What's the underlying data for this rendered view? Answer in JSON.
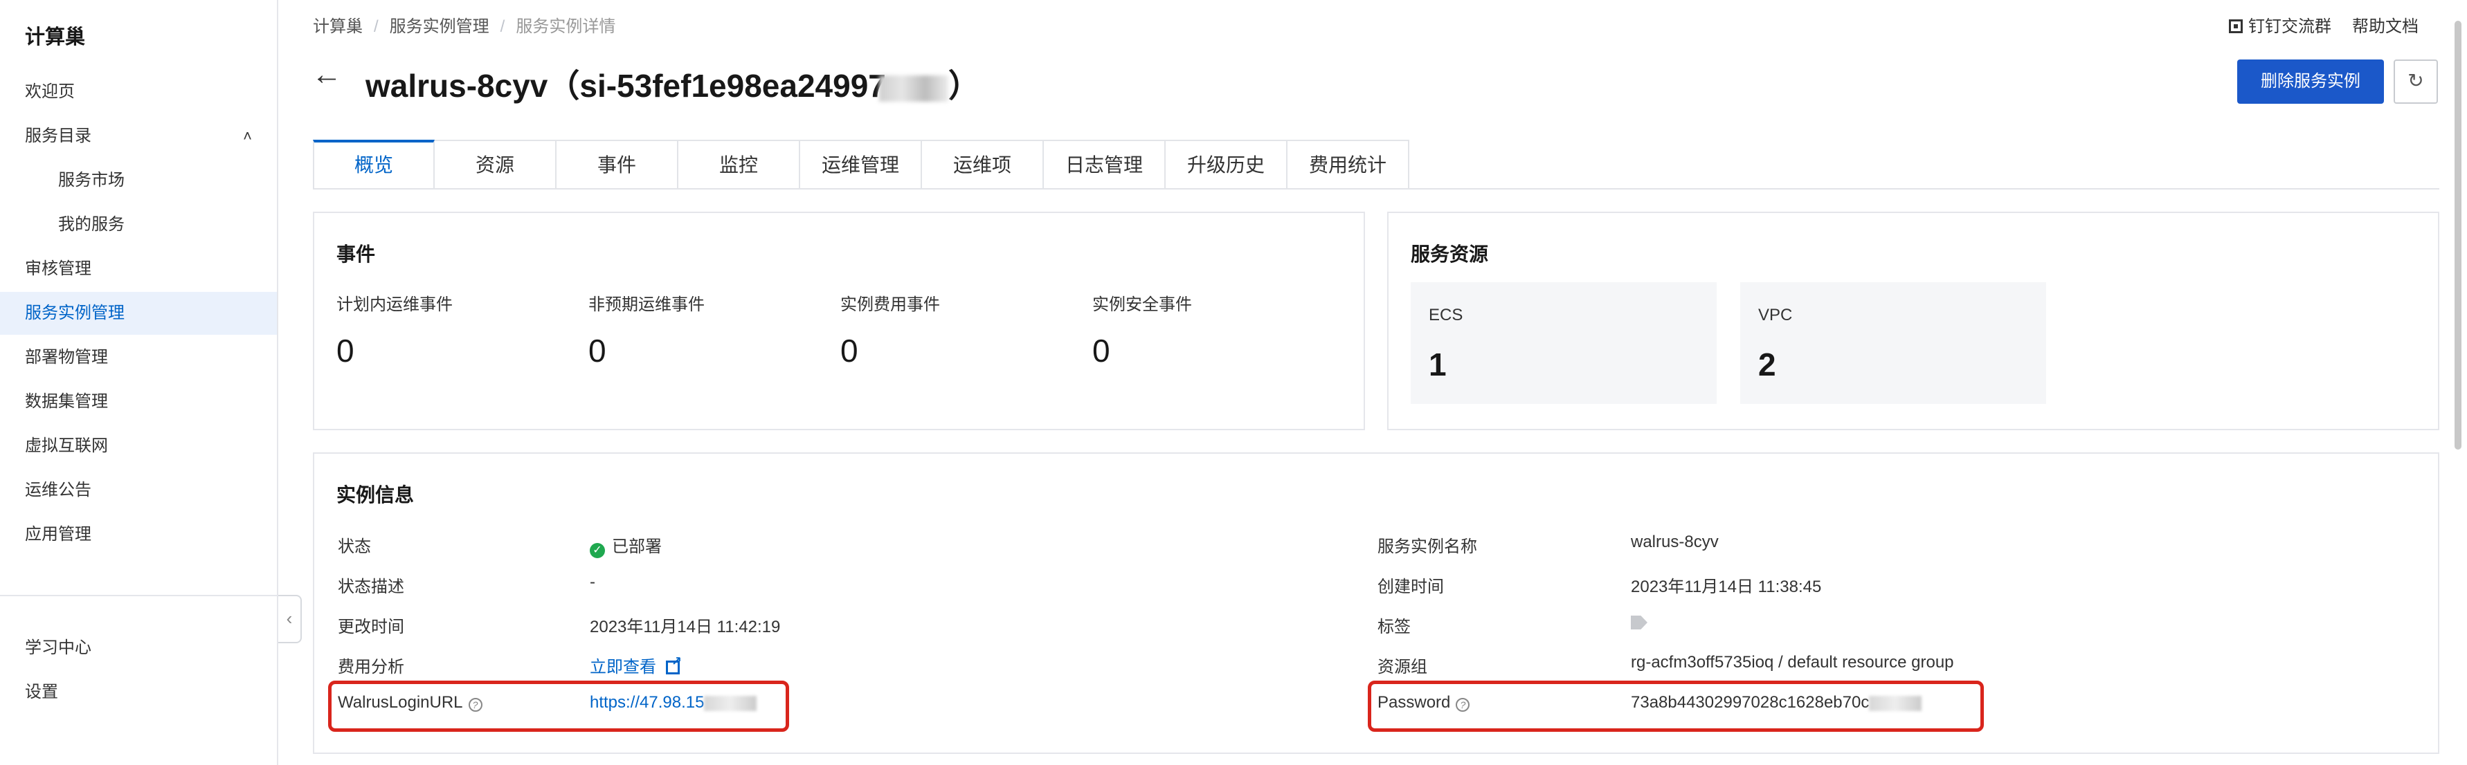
{
  "sidebar": {
    "title": "计算巢",
    "items": [
      {
        "label": "欢迎页"
      },
      {
        "label": "服务目录",
        "chevron": "^"
      },
      {
        "label": "服务市场"
      },
      {
        "label": "我的服务"
      },
      {
        "label": "审核管理"
      },
      {
        "label": "服务实例管理"
      },
      {
        "label": "部署物管理"
      },
      {
        "label": "数据集管理"
      },
      {
        "label": "虚拟互联网"
      },
      {
        "label": "运维公告"
      },
      {
        "label": "应用管理"
      }
    ],
    "bottom_items": [
      {
        "label": "学习中心"
      },
      {
        "label": "设置"
      }
    ],
    "collapse_glyph": "‹"
  },
  "breadcrumb": [
    "计算巢",
    "服务实例管理",
    "服务实例详情"
  ],
  "top_links": {
    "dingtalk": "钉钉交流群",
    "help": "帮助文档"
  },
  "header": {
    "back_glyph": "←",
    "title": "walrus-8cyv（si-53fef1e98ea24997",
    "title_suffix": "）",
    "delete_button": "删除服务实例",
    "refresh_glyph": "↻"
  },
  "tabs": [
    "概览",
    "资源",
    "事件",
    "监控",
    "运维管理",
    "运维项",
    "日志管理",
    "升级历史",
    "费用统计"
  ],
  "events": {
    "title": "事件",
    "items": [
      {
        "label": "计划内运维事件",
        "value": "0"
      },
      {
        "label": "非预期运维事件",
        "value": "0"
      },
      {
        "label": "实例费用事件",
        "value": "0"
      },
      {
        "label": "实例安全事件",
        "value": "0"
      }
    ]
  },
  "resources": {
    "title": "服务资源",
    "items": [
      {
        "label": "ECS",
        "value": "1"
      },
      {
        "label": "VPC",
        "value": "2"
      }
    ]
  },
  "instance_info": {
    "title": "实例信息",
    "left": [
      {
        "label": "状态",
        "value": "已部署"
      },
      {
        "label": "状态描述",
        "value": "-"
      },
      {
        "label": "更改时间",
        "value": "2023年11月14日 11:42:19"
      },
      {
        "label": "费用分析",
        "value": "立即查看"
      },
      {
        "label": "WalrusLoginURL",
        "value": "https://47.98.15"
      }
    ],
    "right": [
      {
        "label": "服务实例名称",
        "value": "walrus-8cyv"
      },
      {
        "label": "创建时间",
        "value": "2023年11月14日 11:38:45"
      },
      {
        "label": "标签",
        "value": ""
      },
      {
        "label": "资源组",
        "value": "rg-acfm3off5735ioq / default resource group"
      },
      {
        "label": "Password",
        "value": "73a8b44302997028c1628eb70c"
      }
    ]
  },
  "colors": {
    "accent": "#0064c8",
    "primary_button": "#1b58c9",
    "highlight_box": "#d9251c",
    "status_ok": "#1fa84f"
  }
}
